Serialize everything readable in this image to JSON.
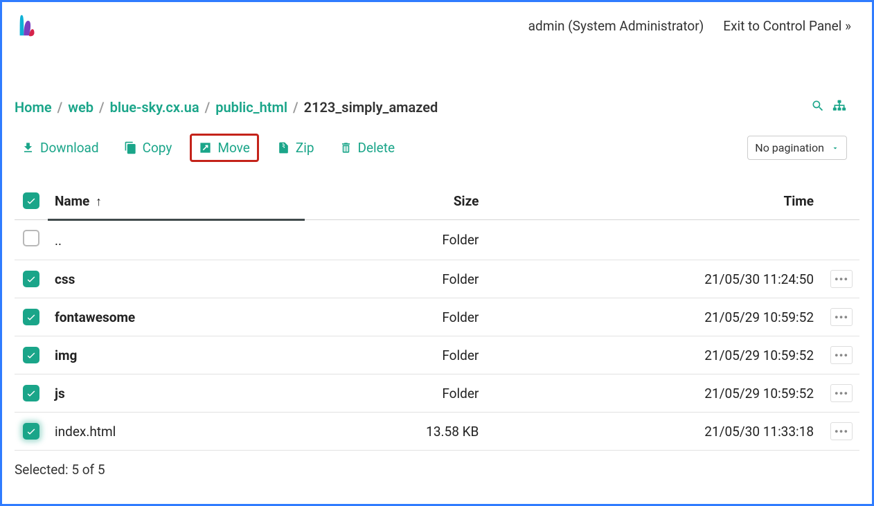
{
  "header": {
    "user": "admin (System Administrator)",
    "exit": "Exit to Control Panel »"
  },
  "breadcrumb": [
    {
      "label": "Home",
      "current": false
    },
    {
      "label": "web",
      "current": false
    },
    {
      "label": "blue-sky.cx.ua",
      "current": false
    },
    {
      "label": "public_html",
      "current": false
    },
    {
      "label": "2123_simply_amazed",
      "current": true
    }
  ],
  "toolbar": {
    "download": "Download",
    "copy": "Copy",
    "move": "Move",
    "zip": "Zip",
    "delete": "Delete"
  },
  "pagination": "No pagination",
  "columns": {
    "name": "Name",
    "size": "Size",
    "time": "Time"
  },
  "rows": [
    {
      "checked": false,
      "name": "..",
      "bold": false,
      "size": "Folder",
      "time": "",
      "actions": false
    },
    {
      "checked": true,
      "name": "css",
      "bold": true,
      "size": "Folder",
      "time": "21/05/30 11:24:50",
      "actions": true
    },
    {
      "checked": true,
      "name": "fontawesome",
      "bold": true,
      "size": "Folder",
      "time": "21/05/29 10:59:52",
      "actions": true
    },
    {
      "checked": true,
      "name": "img",
      "bold": true,
      "size": "Folder",
      "time": "21/05/29 10:59:52",
      "actions": true
    },
    {
      "checked": true,
      "name": "js",
      "bold": true,
      "size": "Folder",
      "time": "21/05/29 10:59:52",
      "actions": true
    },
    {
      "checked": true,
      "glow": true,
      "name": "index.html",
      "bold": false,
      "size": "13.58 KB",
      "time": "21/05/30 11:33:18",
      "actions": true
    }
  ],
  "footer": "Selected: 5 of 5"
}
